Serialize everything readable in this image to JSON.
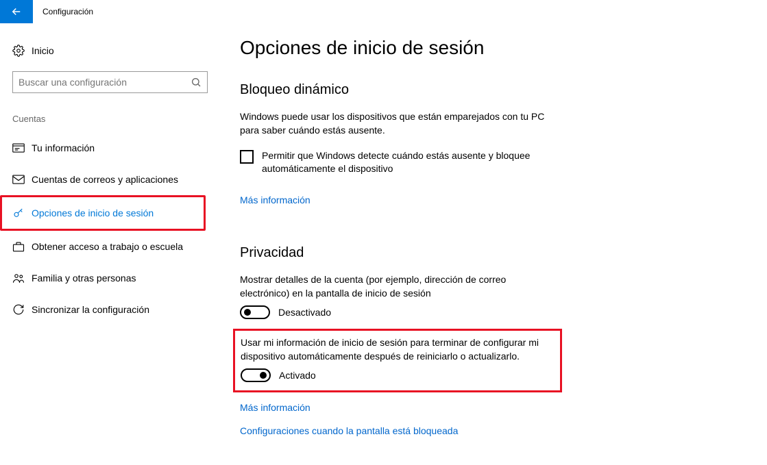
{
  "titlebar": {
    "label": "Configuración"
  },
  "sidebar": {
    "home": "Inicio",
    "search_placeholder": "Buscar una configuración",
    "section": "Cuentas",
    "items": [
      {
        "label": "Tu información"
      },
      {
        "label": "Cuentas de correos y aplicaciones"
      },
      {
        "label": "Opciones de inicio de sesión"
      },
      {
        "label": "Obtener acceso a trabajo o escuela"
      },
      {
        "label": "Familia y otras personas"
      },
      {
        "label": "Sincronizar la configuración"
      }
    ]
  },
  "main": {
    "title": "Opciones de inicio de sesión",
    "dynlock": {
      "heading": "Bloqueo dinámico",
      "desc": "Windows puede usar los dispositivos que están emparejados con tu PC para saber cuándo estás ausente.",
      "checkbox_label": "Permitir que Windows detecte cuándo estás ausente y bloquee automáticamente el dispositivo",
      "more": "Más información"
    },
    "privacy": {
      "heading": "Privacidad",
      "opt1_desc": "Mostrar detalles de la cuenta (por ejemplo, dirección de correo electrónico) en la pantalla de inicio de sesión",
      "opt1_state": "Desactivado",
      "opt2_desc": "Usar mi información de inicio de sesión para terminar de configurar mi dispositivo automáticamente después de reiniciarlo o actualizarlo.",
      "opt2_state": "Activado",
      "more": "Más información",
      "lockscreen_link": "Configuraciones cuando la pantalla está bloqueada"
    }
  }
}
